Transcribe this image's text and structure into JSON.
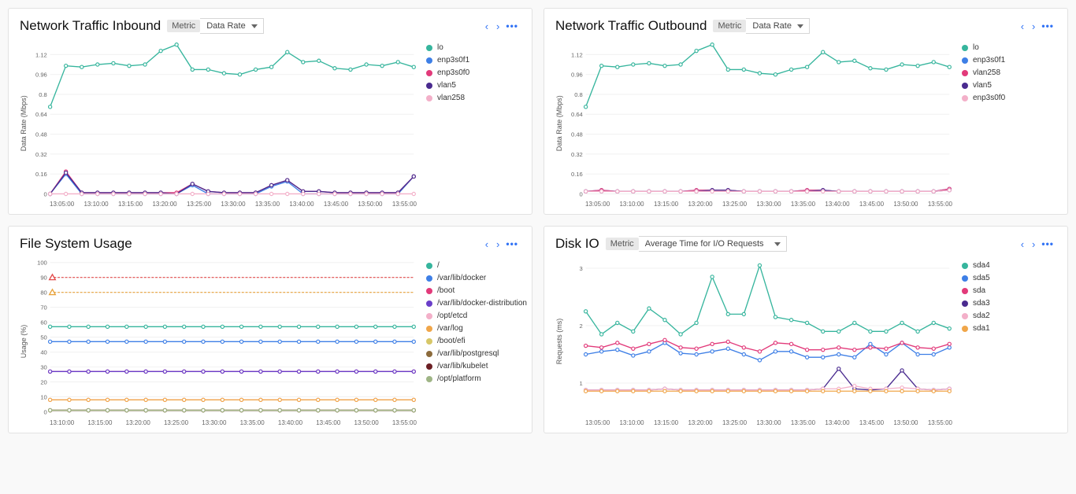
{
  "panels": {
    "net_in": {
      "title": "Network Traffic Inbound",
      "metric_label": "Metric",
      "metric_value": "Data Rate"
    },
    "net_out": {
      "title": "Network Traffic Outbound",
      "metric_label": "Metric",
      "metric_value": "Data Rate"
    },
    "fs": {
      "title": "File System Usage"
    },
    "disk": {
      "title": "Disk IO",
      "metric_label": "Metric",
      "metric_value": "Average Time for I/O Requests"
    }
  },
  "chart_data": [
    {
      "id": "net_in",
      "type": "line",
      "title": "Network Traffic Inbound",
      "ylabel": "Data Rate (Mbps)",
      "xlabel": "",
      "ylim": [
        0,
        1.2
      ],
      "yticks": [
        0,
        0.16,
        0.32,
        0.48,
        0.64,
        0.8,
        0.96,
        1.12
      ],
      "categories": [
        "13:05:00",
        "13:10:00",
        "13:15:00",
        "13:20:00",
        "13:25:00",
        "13:30:00",
        "13:35:00",
        "13:40:00",
        "13:45:00",
        "13:50:00",
        "13:55:00"
      ],
      "x": [
        0,
        1,
        2,
        3,
        4,
        5,
        6,
        7,
        8,
        9,
        10,
        11,
        12,
        13,
        14,
        15,
        16,
        17,
        18,
        19,
        20,
        21,
        22,
        23
      ],
      "series": [
        {
          "name": "lo",
          "color": "#36b59d",
          "values": [
            0.7,
            1.03,
            1.02,
            1.04,
            1.05,
            1.03,
            1.04,
            1.15,
            1.2,
            1.0,
            1.0,
            0.97,
            0.96,
            1.0,
            1.02,
            1.14,
            1.06,
            1.07,
            1.01,
            1.0,
            1.04,
            1.03,
            1.06,
            1.02
          ]
        },
        {
          "name": "enp3s0f1",
          "color": "#3e7fe6",
          "values": [
            0.0,
            0.16,
            0.0,
            0.0,
            0.0,
            0.0,
            0.0,
            0.0,
            0.0,
            0.07,
            0.0,
            0.0,
            0.0,
            0.0,
            0.06,
            0.1,
            0.0,
            0.0,
            0.0,
            0.0,
            0.0,
            0.0,
            0.0,
            0.14
          ]
        },
        {
          "name": "enp3s0f0",
          "color": "#e23a7a",
          "values": [
            0.0,
            0.18,
            0.01,
            0.01,
            0.01,
            0.01,
            0.01,
            0.01,
            0.01,
            0.08,
            0.02,
            0.01,
            0.01,
            0.01,
            0.07,
            0.11,
            0.02,
            0.02,
            0.01,
            0.01,
            0.01,
            0.01,
            0.01,
            0.14
          ]
        },
        {
          "name": "vlan5",
          "color": "#4a2b8f",
          "values": [
            0.0,
            0.17,
            0.01,
            0.01,
            0.01,
            0.01,
            0.01,
            0.01,
            0.0,
            0.08,
            0.02,
            0.01,
            0.01,
            0.01,
            0.07,
            0.11,
            0.02,
            0.02,
            0.01,
            0.01,
            0.01,
            0.01,
            0.01,
            0.14
          ]
        },
        {
          "name": "vlan258",
          "color": "#f3b0c9",
          "values": [
            0.0,
            0.0,
            0.0,
            0.0,
            0.0,
            0.0,
            0.0,
            0.0,
            0.0,
            0.0,
            0.0,
            0.0,
            0.0,
            0.0,
            0.0,
            0.0,
            0.0,
            0.0,
            0.0,
            0.0,
            0.0,
            0.0,
            0.0,
            0.0
          ]
        }
      ]
    },
    {
      "id": "net_out",
      "type": "line",
      "title": "Network Traffic Outbound",
      "ylabel": "Data Rate (Mbps)",
      "xlabel": "",
      "ylim": [
        0,
        1.2
      ],
      "yticks": [
        0,
        0.16,
        0.32,
        0.48,
        0.64,
        0.8,
        0.96,
        1.12
      ],
      "categories": [
        "13:05:00",
        "13:10:00",
        "13:15:00",
        "13:20:00",
        "13:25:00",
        "13:30:00",
        "13:35:00",
        "13:40:00",
        "13:45:00",
        "13:50:00",
        "13:55:00"
      ],
      "x": [
        0,
        1,
        2,
        3,
        4,
        5,
        6,
        7,
        8,
        9,
        10,
        11,
        12,
        13,
        14,
        15,
        16,
        17,
        18,
        19,
        20,
        21,
        22,
        23
      ],
      "series": [
        {
          "name": "lo",
          "color": "#36b59d",
          "values": [
            0.7,
            1.03,
            1.02,
            1.04,
            1.05,
            1.03,
            1.04,
            1.15,
            1.2,
            1.0,
            1.0,
            0.97,
            0.96,
            1.0,
            1.02,
            1.14,
            1.06,
            1.07,
            1.01,
            1.0,
            1.04,
            1.03,
            1.06,
            1.02
          ]
        },
        {
          "name": "enp3s0f1",
          "color": "#3e7fe6",
          "values": [
            0.02,
            0.03,
            0.02,
            0.02,
            0.02,
            0.02,
            0.02,
            0.03,
            0.03,
            0.03,
            0.02,
            0.02,
            0.02,
            0.02,
            0.03,
            0.03,
            0.02,
            0.02,
            0.02,
            0.02,
            0.02,
            0.02,
            0.02,
            0.04
          ]
        },
        {
          "name": "vlan258",
          "color": "#e23a7a",
          "values": [
            0.02,
            0.03,
            0.02,
            0.02,
            0.02,
            0.02,
            0.02,
            0.03,
            0.03,
            0.03,
            0.02,
            0.02,
            0.02,
            0.02,
            0.03,
            0.03,
            0.02,
            0.02,
            0.02,
            0.02,
            0.02,
            0.02,
            0.02,
            0.04
          ]
        },
        {
          "name": "vlan5",
          "color": "#4a2b8f",
          "values": [
            0.02,
            0.02,
            0.02,
            0.02,
            0.02,
            0.02,
            0.02,
            0.02,
            0.03,
            0.03,
            0.02,
            0.02,
            0.02,
            0.02,
            0.02,
            0.03,
            0.02,
            0.02,
            0.02,
            0.02,
            0.02,
            0.02,
            0.02,
            0.03
          ]
        },
        {
          "name": "enp3s0f0",
          "color": "#f3b0c9",
          "values": [
            0.02,
            0.02,
            0.02,
            0.02,
            0.02,
            0.02,
            0.02,
            0.02,
            0.02,
            0.02,
            0.02,
            0.02,
            0.02,
            0.02,
            0.02,
            0.02,
            0.02,
            0.02,
            0.02,
            0.02,
            0.02,
            0.02,
            0.02,
            0.03
          ]
        }
      ]
    },
    {
      "id": "fs",
      "type": "line",
      "title": "File System Usage",
      "ylabel": "Usage (%)",
      "xlabel": "",
      "ylim": [
        0,
        100
      ],
      "yticks": [
        0,
        10,
        20,
        30,
        40,
        50,
        60,
        70,
        80,
        90,
        100
      ],
      "thresholds": [
        {
          "value": 90,
          "color": "#e34a4a"
        },
        {
          "value": 80,
          "color": "#e8a23a"
        }
      ],
      "categories": [
        "13:10:00",
        "13:15:00",
        "13:20:00",
        "13:25:00",
        "13:30:00",
        "13:35:00",
        "13:40:00",
        "13:45:00",
        "13:50:00",
        "13:55:00"
      ],
      "x": [
        0,
        1,
        2,
        3,
        4,
        5,
        6,
        7,
        8,
        9,
        10,
        11,
        12,
        13,
        14,
        15,
        16,
        17,
        18,
        19
      ],
      "series": [
        {
          "name": "/",
          "color": "#36b59d",
          "values": [
            57,
            57,
            57,
            57,
            57,
            57,
            57,
            57,
            57,
            57,
            57,
            57,
            57,
            57,
            57,
            57,
            57,
            57,
            57,
            57
          ]
        },
        {
          "name": "/var/lib/docker",
          "color": "#3e7fe6",
          "values": [
            47,
            47,
            47,
            47,
            47,
            47,
            47,
            47,
            47,
            47,
            47,
            47,
            47,
            47,
            47,
            47,
            47,
            47,
            47,
            47
          ]
        },
        {
          "name": "/boot",
          "color": "#e23a7a",
          "values": [
            27,
            27,
            27,
            27,
            27,
            27,
            27,
            27,
            27,
            27,
            27,
            27,
            27,
            27,
            27,
            27,
            27,
            27,
            27,
            27
          ]
        },
        {
          "name": "/var/lib/docker-distribution",
          "color": "#6a3ec9",
          "values": [
            27,
            27,
            27,
            27,
            27,
            27,
            27,
            27,
            27,
            27,
            27,
            27,
            27,
            27,
            27,
            27,
            27,
            27,
            27,
            27
          ]
        },
        {
          "name": "/opt/etcd",
          "color": "#f3b0c9",
          "values": [
            8,
            8,
            8,
            8,
            8,
            8,
            8,
            8,
            8,
            8,
            8,
            8,
            8,
            8,
            8,
            8,
            8,
            8,
            8,
            8
          ]
        },
        {
          "name": "/var/log",
          "color": "#f0a64a",
          "values": [
            8,
            8,
            8,
            8,
            8,
            8,
            8,
            8,
            8,
            8,
            8,
            8,
            8,
            8,
            8,
            8,
            8,
            8,
            8,
            8
          ]
        },
        {
          "name": "/boot/efi",
          "color": "#d7c768",
          "values": [
            1,
            1,
            1,
            1,
            1,
            1,
            1,
            1,
            1,
            1,
            1,
            1,
            1,
            1,
            1,
            1,
            1,
            1,
            1,
            1
          ]
        },
        {
          "name": "/var/lib/postgresql",
          "color": "#8c6b3c",
          "values": [
            1,
            1,
            1,
            1,
            1,
            1,
            1,
            1,
            1,
            1,
            1,
            1,
            1,
            1,
            1,
            1,
            1,
            1,
            1,
            1
          ]
        },
        {
          "name": "/var/lib/kubelet",
          "color": "#6b1f24",
          "values": [
            1,
            1,
            1,
            1,
            1,
            1,
            1,
            1,
            1,
            1,
            1,
            1,
            1,
            1,
            1,
            1,
            1,
            1,
            1,
            1
          ]
        },
        {
          "name": "/opt/platform",
          "color": "#9fb586",
          "values": [
            1,
            1,
            1,
            1,
            1,
            1,
            1,
            1,
            1,
            1,
            1,
            1,
            1,
            1,
            1,
            1,
            1,
            1,
            1,
            1
          ]
        }
      ]
    },
    {
      "id": "disk",
      "type": "line",
      "title": "Disk IO",
      "ylabel": "Requests (ms)",
      "xlabel": "",
      "ylim": [
        0.5,
        3.1
      ],
      "yticks": [
        1,
        2,
        3
      ],
      "categories": [
        "13:05:00",
        "13:10:00",
        "13:15:00",
        "13:20:00",
        "13:25:00",
        "13:30:00",
        "13:35:00",
        "13:40:00",
        "13:45:00",
        "13:50:00",
        "13:55:00"
      ],
      "x": [
        0,
        1,
        2,
        3,
        4,
        5,
        6,
        7,
        8,
        9,
        10,
        11,
        12,
        13,
        14,
        15,
        16,
        17,
        18,
        19,
        20,
        21,
        22,
        23
      ],
      "series": [
        {
          "name": "sda4",
          "color": "#36b59d",
          "values": [
            2.25,
            1.85,
            2.05,
            1.9,
            2.3,
            2.1,
            1.85,
            2.05,
            2.85,
            2.2,
            2.2,
            3.05,
            2.15,
            2.1,
            2.05,
            1.9,
            1.9,
            2.05,
            1.9,
            1.9,
            2.05,
            1.9,
            2.05,
            1.95
          ]
        },
        {
          "name": "sda5",
          "color": "#3e7fe6",
          "values": [
            1.5,
            1.55,
            1.58,
            1.48,
            1.55,
            1.7,
            1.52,
            1.5,
            1.55,
            1.6,
            1.5,
            1.4,
            1.55,
            1.55,
            1.45,
            1.45,
            1.5,
            1.45,
            1.68,
            1.5,
            1.7,
            1.5,
            1.5,
            1.62
          ]
        },
        {
          "name": "sda",
          "color": "#e23a7a",
          "values": [
            1.65,
            1.62,
            1.7,
            1.6,
            1.68,
            1.75,
            1.62,
            1.6,
            1.68,
            1.72,
            1.62,
            1.55,
            1.7,
            1.68,
            1.58,
            1.58,
            1.62,
            1.58,
            1.62,
            1.6,
            1.7,
            1.62,
            1.6,
            1.68
          ]
        },
        {
          "name": "sda3",
          "color": "#4a2b8f",
          "values": [
            0.88,
            0.88,
            0.88,
            0.88,
            0.88,
            0.9,
            0.88,
            0.88,
            0.88,
            0.88,
            0.88,
            0.88,
            0.88,
            0.88,
            0.88,
            0.9,
            1.25,
            0.9,
            0.88,
            0.9,
            1.22,
            0.9,
            0.88,
            0.9
          ]
        },
        {
          "name": "sda2",
          "color": "#f3b0c9",
          "values": [
            0.88,
            0.88,
            0.88,
            0.88,
            0.88,
            0.9,
            0.88,
            0.88,
            0.88,
            0.88,
            0.88,
            0.88,
            0.88,
            0.88,
            0.88,
            0.9,
            0.9,
            0.95,
            0.9,
            0.9,
            0.92,
            0.9,
            0.88,
            0.9
          ]
        },
        {
          "name": "sda1",
          "color": "#f0a64a",
          "values": [
            0.86,
            0.86,
            0.86,
            0.86,
            0.86,
            0.86,
            0.86,
            0.86,
            0.86,
            0.86,
            0.86,
            0.86,
            0.86,
            0.86,
            0.86,
            0.86,
            0.86,
            0.86,
            0.86,
            0.86,
            0.86,
            0.86,
            0.86,
            0.86
          ]
        }
      ]
    }
  ]
}
